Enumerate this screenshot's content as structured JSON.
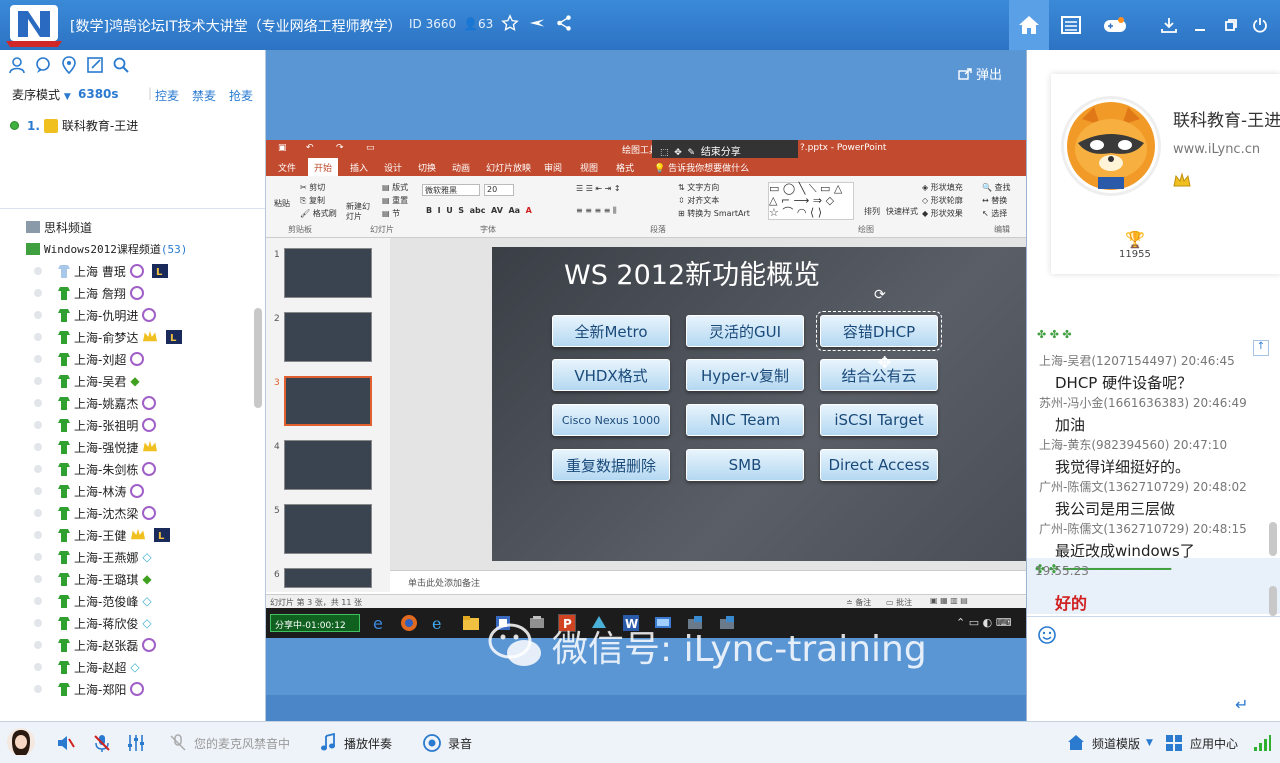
{
  "window": {
    "title": "[数学]鸿鹄论坛IT技术大讲堂（专业网络工程师教学）",
    "room_id": "ID 3660",
    "user_count": "63"
  },
  "left_panel": {
    "mic_mode": "麦序模式",
    "mic_time": "6380s",
    "actions": [
      "控麦",
      "禁麦",
      "抢麦"
    ],
    "queue_item": {
      "index": "1.",
      "name": "联科教育-王进"
    },
    "channels": [
      {
        "name": "思科频道"
      },
      {
        "name": "Windows2012课程频道",
        "count": "(53)"
      }
    ],
    "users": [
      {
        "name": "上海 曹珉",
        "badge": true,
        "extra": "lol"
      },
      {
        "name": "上海 詹翔",
        "badge": true
      },
      {
        "name": "上海-仇明进",
        "badge": true
      },
      {
        "name": "上海-俞梦达",
        "badge": false,
        "crown": true,
        "extra": "lol"
      },
      {
        "name": "上海-刘超",
        "badge": true
      },
      {
        "name": "上海-吴君",
        "badge": false,
        "gem": true
      },
      {
        "name": "上海-姚嘉杰",
        "badge": true
      },
      {
        "name": "上海-张祖明",
        "badge": true
      },
      {
        "name": "上海-强悦捷",
        "badge": false,
        "crown": true
      },
      {
        "name": "上海-朱剑栋",
        "badge": true
      },
      {
        "name": "上海-林涛",
        "badge": true
      },
      {
        "name": "上海-沈杰梁",
        "badge": true
      },
      {
        "name": "上海-王健",
        "badge": false,
        "crown": true,
        "extra": "lol"
      },
      {
        "name": "上海-王燕娜",
        "badge": false,
        "diamond": true
      },
      {
        "name": "上海-王璐琪",
        "badge": false,
        "gem": true
      },
      {
        "name": "上海-范俊峰",
        "badge": false,
        "diamond": true
      },
      {
        "name": "上海-蒋欣俊",
        "badge": false,
        "diamond": true
      },
      {
        "name": "上海-赵张磊",
        "badge": true
      },
      {
        "name": "上海-赵超",
        "badge": false,
        "diamond": true
      },
      {
        "name": "上海-郑阳",
        "badge": true
      }
    ]
  },
  "center": {
    "popout_label": "弹出",
    "ppt": {
      "title_tools": "绘图工具",
      "title_share": "结束分享",
      "title_file": "?.pptx - PowerPoint",
      "tabs": [
        "文件",
        "开始",
        "插入",
        "设计",
        "切换",
        "动画",
        "幻灯片放映",
        "审阅",
        "视图",
        "格式"
      ],
      "tell_me": "告诉我你想要做什么",
      "ribbon_groups": [
        "剪贴板",
        "幻灯片",
        "字体",
        "段落",
        "绘图",
        "编辑"
      ],
      "ribbon": {
        "paste": "粘贴",
        "cut": "剪切",
        "copy": "复制",
        "format_painter": "格式刷",
        "new_slide": "新建幻灯片",
        "layout": "版式",
        "reset": "重置",
        "section": "节",
        "font_name": "微软雅黑",
        "font_size": "20",
        "text_direction": "文字方向",
        "align_text": "对齐文本",
        "smartart": "转换为 SmartArt",
        "arrange": "排列",
        "quick_styles": "快速样式",
        "shape_fill": "形状填充",
        "shape_outline": "形状轮廓",
        "shape_effects": "形状效果",
        "find": "查找",
        "replace": "替换",
        "select": "选择"
      },
      "slide_title": "WS 2012新功能概览",
      "features": [
        [
          "全新Metro",
          "灵活的GUI",
          "容错DHCP"
        ],
        [
          "VHDX格式",
          "Hyper-v复制",
          "结合公有云"
        ],
        [
          "Cisco Nexus 1000",
          "NIC Team",
          "iSCSI Target"
        ],
        [
          "重复数据删除",
          "SMB",
          "Direct Access"
        ]
      ],
      "notes_placeholder": "单击此处添加备注",
      "status_left": "幻灯片 第 3 张，共 11 张",
      "status_notes": "备注",
      "status_comments": "批注",
      "thumb_numbers": [
        "1",
        "2",
        "3",
        "4",
        "5",
        "6"
      ]
    },
    "taskbar": {
      "share_time": "分享中-01:00:12"
    },
    "watermark": "微信号: iLync-training"
  },
  "right_panel": {
    "profile_name": "联科教育-王进",
    "profile_url": "www.iLync.cn",
    "flowers": "11955",
    "chat": [
      {
        "meta": "上海-吴君(1207154497) 20:46:45",
        "msg": "DHCP 硬件设备呢？"
      },
      {
        "meta": "苏州-冯小金(1661636383) 20:46:49",
        "msg": "加油"
      },
      {
        "meta": "上海-黄东(982394560) 20:47:10",
        "msg": "我觉得详细挺好的。"
      },
      {
        "meta": "广州-陈儒文(1362710729) 20:48:02",
        "msg": "我公司是用三层做"
      },
      {
        "meta": "广州-陈儒文(1362710729) 20:48:15",
        "msg": "最近改成windows了"
      }
    ],
    "last_meta": "19:55:23",
    "last_msg": "好的"
  },
  "bottom_bar": {
    "mic_muted": "您的麦克风禁音中",
    "play_music": "播放伴奏",
    "record": "录音",
    "channel_template": "频道模版",
    "app_center": "应用中心"
  },
  "colors": {
    "titlebar": "#2d73c4",
    "ppt_red": "#c24a2e",
    "chat_highlight": "#d02020",
    "link_blue": "#2a7ad0"
  }
}
